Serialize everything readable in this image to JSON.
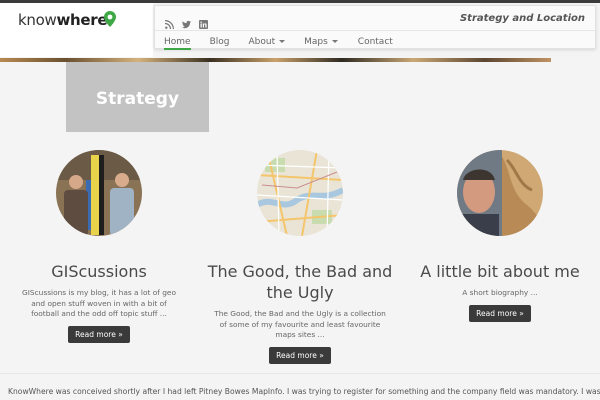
{
  "header": {
    "logo_light": "know",
    "logo_bold": "where",
    "tagline": "Strategy and Location",
    "social_icons": [
      "rss-icon",
      "twitter-icon",
      "linkedin-icon"
    ],
    "nav": [
      {
        "label": "Home"
      },
      {
        "label": "Blog"
      },
      {
        "label": "About"
      },
      {
        "label": "Maps"
      },
      {
        "label": "Contact"
      }
    ]
  },
  "hero": {
    "title": "Strategy"
  },
  "columns": [
    {
      "title": "GIScussions",
      "text": "GIScussions is my blog, it has a lot of geo and open stuff woven in with a bit of football and the odd off topic stuff ...",
      "button": "Read more »"
    },
    {
      "title": "The Good, the Bad and the Ugly",
      "text": "The Good, the Bad and the Ugly is a collection of some of my favourite and least favourite maps sites ...",
      "button": "Read more »"
    },
    {
      "title": "A little bit about me",
      "text": "A short biography ...",
      "button": "Read more »"
    }
  ],
  "about_text": "KnowWhere was conceived shortly after I had left Pitney Bowes MapInfo. I was trying to register for something and the company field was mandatory. I was asked \"where",
  "colors": {
    "brand_green": "#3ea846",
    "button_dark": "#3a3a3a",
    "hero_grey": "#c3c3c3"
  }
}
